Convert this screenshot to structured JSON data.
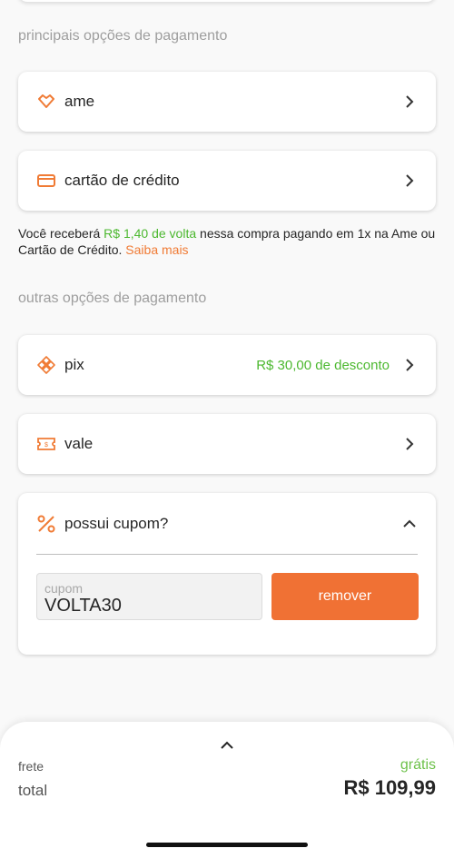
{
  "sections": {
    "main_title": "principais opções de pagamento",
    "other_title": "outras opções de pagamento"
  },
  "payment_main": [
    {
      "label": "ame",
      "icon": "ame-heart-icon"
    },
    {
      "label": "cartão de crédito",
      "icon": "credit-card-icon"
    }
  ],
  "cashback": {
    "prefix": "Você receberá ",
    "amount": "R$ 1,40 de volta",
    "suffix": " nessa compra pagando em 1x na Ame ou Cartão de Crédito. ",
    "link": "Saiba mais"
  },
  "payment_other": [
    {
      "label": "pix",
      "icon": "pix-icon",
      "extra": "R$ 30,00 de desconto"
    },
    {
      "label": "vale",
      "icon": "voucher-icon"
    }
  ],
  "coupon": {
    "title": "possui cupom?",
    "field_label": "cupom",
    "value": "VOLTA30",
    "button": "remover"
  },
  "summary": {
    "frete_label": "frete",
    "frete_value": "grátis",
    "total_label": "total",
    "total_value": "R$ 109,99"
  },
  "colors": {
    "accent": "#f07134",
    "green": "#4cb82f"
  }
}
